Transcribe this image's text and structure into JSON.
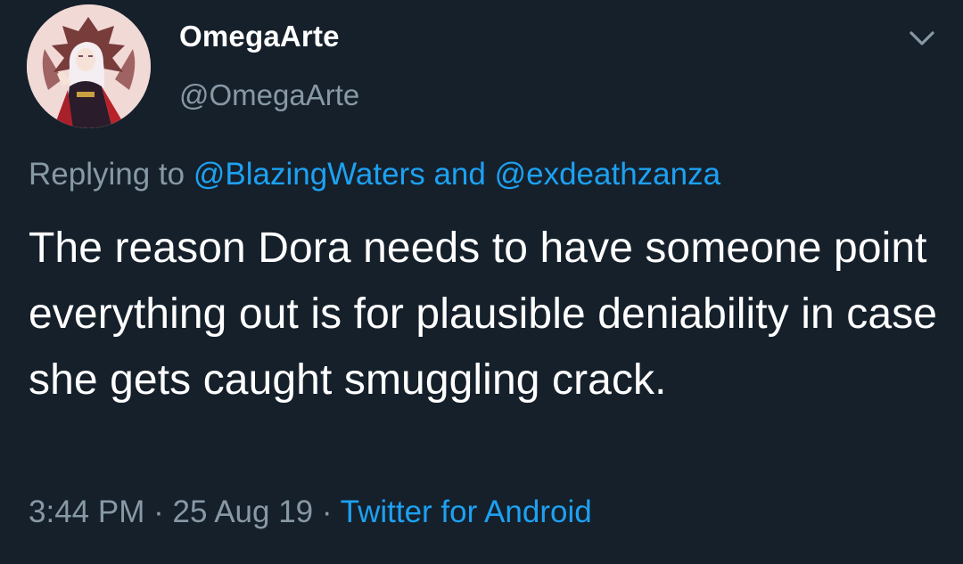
{
  "user": {
    "display_name": "OmegaArte",
    "handle": "@OmegaArte",
    "avatar_icon": "anime-character-avatar"
  },
  "reply": {
    "prefix": "Replying to",
    "mention_1": "@BlazingWaters",
    "conjunction": "and",
    "mention_2": "@exdeathzanza"
  },
  "tweet": {
    "text": "The reason Dora needs to have someone point everything out is for plausible deniability in case she gets caught smuggling crack."
  },
  "meta": {
    "time": "3:44 PM",
    "separator_1": "·",
    "date": "25 Aug 19",
    "separator_2": "·",
    "source": "Twitter for Android"
  },
  "colors": {
    "background": "#15202b",
    "text_primary": "#ffffff",
    "text_secondary": "#8899a6",
    "link": "#1da1f2"
  }
}
